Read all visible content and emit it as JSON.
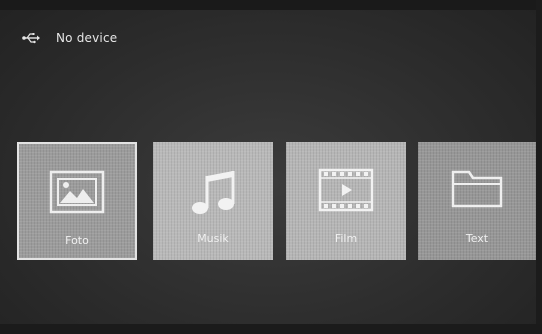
{
  "status": {
    "icon": "usb-icon",
    "device_label": "No device"
  },
  "menu": {
    "tiles": [
      {
        "label": "Foto",
        "icon": "photo-icon",
        "selected": true
      },
      {
        "label": "Musik",
        "icon": "music-icon",
        "selected": false
      },
      {
        "label": "Film",
        "icon": "film-icon",
        "selected": false
      },
      {
        "label": "Text",
        "icon": "folder-icon",
        "selected": false
      }
    ]
  },
  "colors": {
    "background": "#2e2e2e",
    "tile": "#a7a7a7",
    "selected_border": "#e3e3e3",
    "text": "#f0f0f0"
  }
}
